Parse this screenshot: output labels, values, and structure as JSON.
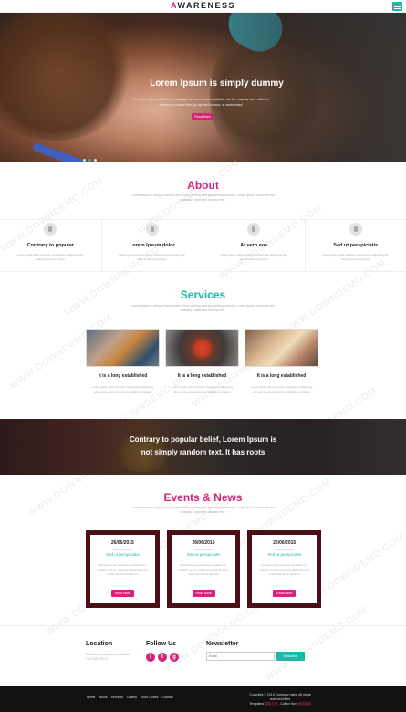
{
  "header": {
    "logo_first": "A",
    "logo_rest": "WARENESS"
  },
  "hero": {
    "title": "Lorem Ipsum is simply dummy",
    "text": "There are many variations of passages of Lorem Ipsum available, but the majority have suffered alteration in some form, by injected humour, or randomised",
    "button": "Read More",
    "slide_count": 3,
    "active_slide": 2
  },
  "about": {
    "title": "About",
    "subtitle": "Lorem ipsum is simply dummy text of the printing and typesetting industry. Lorem Ipsum has been the industry's standard dummy text.",
    "features": [
      {
        "title": "Contrary to popular",
        "text": "Lorem ipsum dolor sit amet, consectetur adipiscing elit, sed do eiusmod tempor"
      },
      {
        "title": "Lorem Ipsum dolor",
        "text": "Lorem ipsum dolor sit amet, consectetur adipiscing elit, sed do eiusmod tempor"
      },
      {
        "title": "At vero eos",
        "text": "Lorem ipsum dolor sit amet, consectetur adipiscing elit, sed do eiusmod tempor"
      },
      {
        "title": "Sed ut perspiciatis",
        "text": "Lorem ipsum dolor sit amet, consectetur adipiscing elit, sed do eiusmod tempor"
      }
    ]
  },
  "services": {
    "title": "Services",
    "subtitle": "Lorem ipsum is simply dummy text of the printing and typesetting industry. Lorem Ipsum has been the industry's standard dummy text.",
    "items": [
      {
        "title": "It is a long established",
        "text": "Lorem ipsum dolor sit amet, consectetur adipiscing elit, sed do eiusmod tempor incididunt ut labore"
      },
      {
        "title": "It is a long established",
        "text": "Lorem ipsum dolor sit amet, consectetur adipiscing elit, sed do eiusmod tempor incididunt ut labore"
      },
      {
        "title": "It is a long established",
        "text": "Lorem ipsum dolor sit amet, consectetur adipiscing elit, sed do eiusmod tempor incididunt ut labore"
      }
    ]
  },
  "quote": {
    "line1": "Contrary to popular belief, Lorem Ipsum is",
    "line2": "not simply random text. It has roots"
  },
  "events": {
    "title": "Events & News",
    "subtitle": "Lorem ipsum is simply dummy text of the printing and typesetting industry. Lorem Ipsum has been the industry's standard dummy text.",
    "items": [
      {
        "date": "26/06/2015",
        "title": "Sed ut perspiciatis",
        "text": "Excepteur sint occaecat cupidatat non proident, sunt in culpa qui officia deserunt mollit anim id est laborum",
        "button": "Read More"
      },
      {
        "date": "26/06/2015",
        "title": "Sed ut perspiciatis",
        "text": "Excepteur sint occaecat cupidatat non proident, sunt in culpa qui officia deserunt mollit anim id est laborum",
        "button": "Read More"
      },
      {
        "date": "26/06/2015",
        "title": "Sed ut perspiciatis",
        "text": "Excepteur sint occaecat cupidatat non proident, sunt in culpa qui officia deserunt mollit anim id est laborum",
        "button": "Read More"
      }
    ]
  },
  "footer": {
    "location_title": "Location",
    "location_text": "Contrary to popular perspiciatis +12 345 678 91",
    "follow_title": "Follow Us",
    "social": [
      "f",
      "t",
      "g"
    ],
    "newsletter_title": "Newsletter",
    "newsletter_placeholder": "Email",
    "newsletter_button": "Subscribe",
    "nav": [
      "Home",
      "About",
      "Services",
      "Gallery",
      "Short Codes",
      "Contact"
    ],
    "copyright_line1": "Copyright © 2015 Company name All rights reserved.More",
    "copyright_line2_pre": "Templates ",
    "copyright_link1": "模板之家",
    "copyright_line2_mid": " - Collect from ",
    "copyright_link2": "网页模板"
  },
  "watermark": "WWW.DOWNDEMO.COM",
  "colors": {
    "accent_pink": "#d6247a",
    "accent_teal": "#1fb8a6",
    "event_border": "#4a1018"
  }
}
